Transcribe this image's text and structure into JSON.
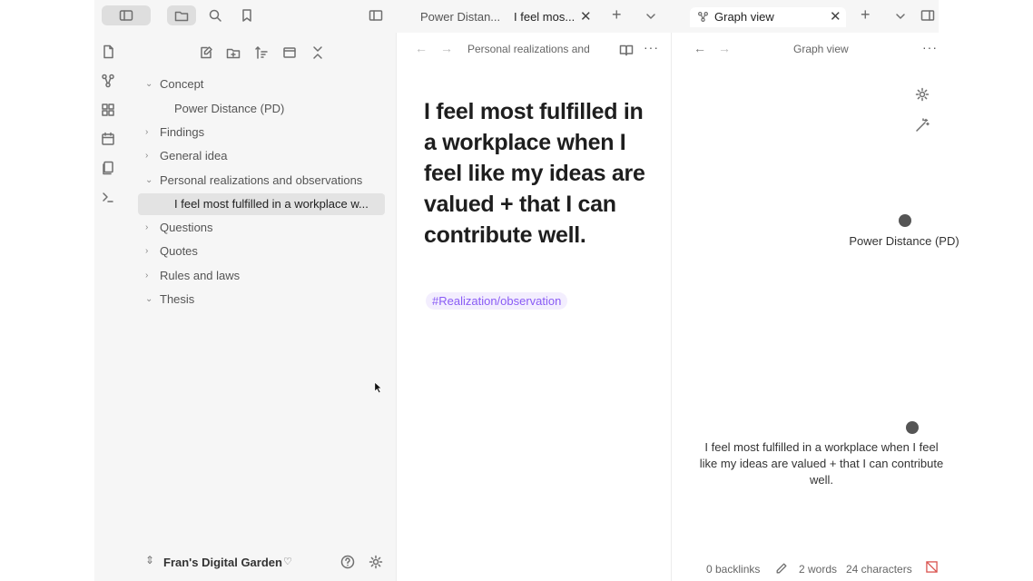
{
  "tabs_left": [
    {
      "label": "Power Distan..."
    },
    {
      "label": "I feel mos..."
    }
  ],
  "tabs_right": [
    {
      "label": "Graph view"
    }
  ],
  "editor_header": {
    "breadcrumb": "Personal realizations and"
  },
  "graph_header": {
    "title": "Graph view"
  },
  "sidebar": {
    "tree": [
      {
        "label": "Concept",
        "expanded": true
      },
      {
        "label": "Power Distance (PD)",
        "child": true
      },
      {
        "label": "Findings",
        "expanded": false
      },
      {
        "label": "General idea",
        "expanded": false
      },
      {
        "label": "Personal realizations and observations",
        "expanded": true
      },
      {
        "label": "I feel most fulfilled in a workplace w...",
        "child": true,
        "active": true
      },
      {
        "label": "Questions",
        "expanded": false
      },
      {
        "label": "Quotes",
        "expanded": false
      },
      {
        "label": "Rules and laws",
        "expanded": false
      },
      {
        "label": "Thesis",
        "expanded": true
      }
    ],
    "vault_name": "Fran's Digital Garden"
  },
  "note": {
    "title": "I feel most fulfilled in a workplace when I feel like my ideas are valued + that I can contribute well.",
    "tag": "#Realization/observation"
  },
  "graph": {
    "nodes": [
      {
        "label": "Power Distance (PD)"
      },
      {
        "label": "I feel most fulfilled in a workplace when I feel like my ideas are valued + that I can contribute well."
      }
    ]
  },
  "status": {
    "backlinks": "0 backlinks",
    "words": "2 words",
    "characters": "24 characters"
  },
  "colors": {
    "accent": "#8a5cf5",
    "tag_bg": "#f3eefe",
    "sidebar_bg": "#f6f6f6"
  }
}
